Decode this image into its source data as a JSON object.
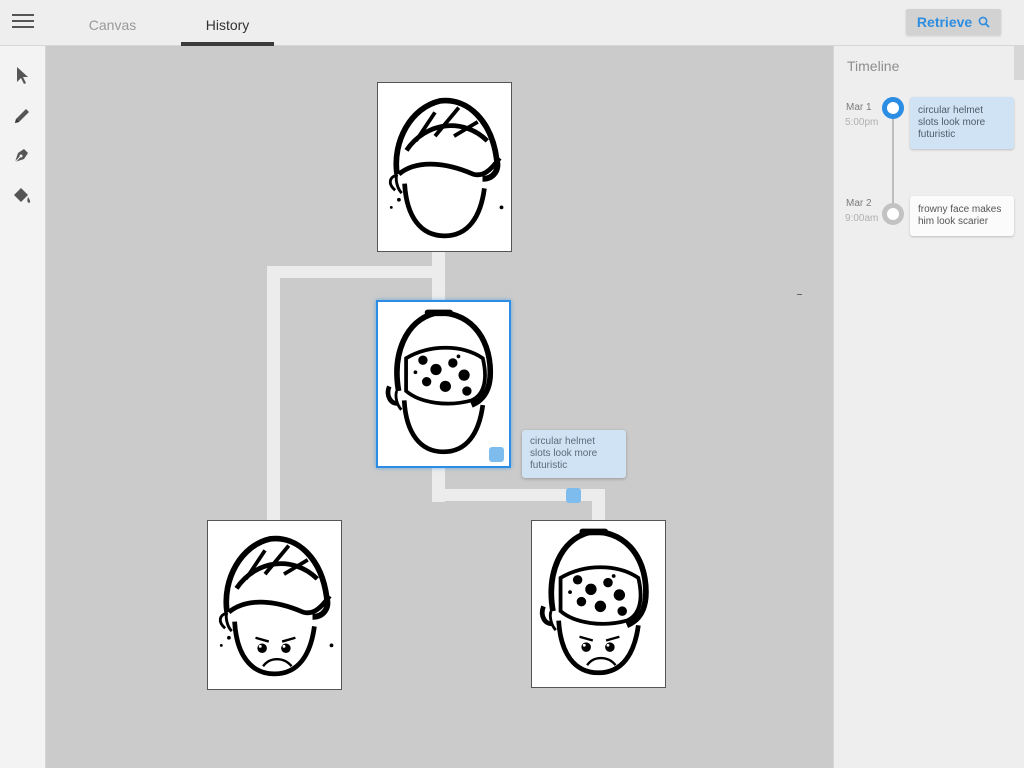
{
  "nav": {
    "menu_icon": "hamburger-menu-icon",
    "tabs": [
      {
        "label": "Canvas",
        "active": false
      },
      {
        "label": "History",
        "active": true
      }
    ],
    "retrieve_label": "Retrieve",
    "retrieve_icon": "search-icon"
  },
  "tools": [
    {
      "name": "select",
      "icon": "cursor-arrow-icon"
    },
    {
      "name": "pencil",
      "icon": "pencil-icon"
    },
    {
      "name": "pen",
      "icon": "pen-nib-icon"
    },
    {
      "name": "fill",
      "icon": "paint-bucket-icon"
    }
  ],
  "canvas": {
    "selected_note": "circular helmet slots look more futuristic"
  },
  "timeline": {
    "title": "Timeline",
    "entries": [
      {
        "date": "Mar 1",
        "time": "5:00pm",
        "note": "circular helmet slots look more futuristic",
        "active": true
      },
      {
        "date": "Mar 2",
        "time": "9:00am",
        "note": "frowny face makes him look scarier",
        "active": false
      }
    ]
  },
  "colors": {
    "accent": "#2b8de3",
    "note_bg": "#cfe3f5",
    "canvas_bg": "#cbcbcb"
  }
}
